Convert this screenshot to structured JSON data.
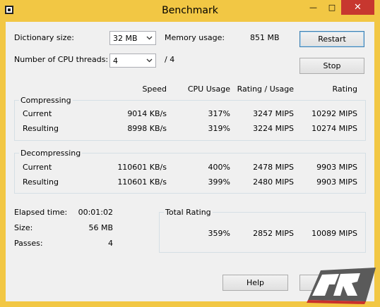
{
  "window": {
    "title": "Benchmark",
    "minimize_glyph": "—",
    "maximize_glyph": "□",
    "close_glyph": "✕",
    "frame_color": "#f2c744",
    "close_color": "#c7372f"
  },
  "settings": {
    "dictionary_size_label": "Dictionary size:",
    "dictionary_size_value": "32 MB",
    "cpu_threads_label": "Number of CPU threads:",
    "cpu_threads_value": "4",
    "cpu_threads_total": "/ 4",
    "memory_usage_label": "Memory usage:",
    "memory_usage_value": "851 MB"
  },
  "buttons": {
    "restart": "Restart",
    "stop": "Stop",
    "help": "Help"
  },
  "columns": {
    "speed": "Speed",
    "cpu_usage": "CPU Usage",
    "rating_usage": "Rating / Usage",
    "rating": "Rating"
  },
  "compressing": {
    "title": "Compressing",
    "rows": [
      {
        "label": "Current",
        "speed": "9014 KB/s",
        "cpu": "317%",
        "rating_usage": "3247 MIPS",
        "rating": "10292 MIPS"
      },
      {
        "label": "Resulting",
        "speed": "8998 KB/s",
        "cpu": "319%",
        "rating_usage": "3224 MIPS",
        "rating": "10274 MIPS"
      }
    ]
  },
  "decompressing": {
    "title": "Decompressing",
    "rows": [
      {
        "label": "Current",
        "speed": "110601 KB/s",
        "cpu": "400%",
        "rating_usage": "2478 MIPS",
        "rating": "9903 MIPS"
      },
      {
        "label": "Resulting",
        "speed": "110601 KB/s",
        "cpu": "399%",
        "rating_usage": "2480 MIPS",
        "rating": "9903 MIPS"
      }
    ]
  },
  "stats": {
    "elapsed_label": "Elapsed time:",
    "elapsed_value": "00:01:02",
    "size_label": "Size:",
    "size_value": "56 MB",
    "passes_label": "Passes:",
    "passes_value": "4"
  },
  "total": {
    "title": "Total Rating",
    "cpu": "359%",
    "rating_usage": "2852 MIPS",
    "rating": "10089 MIPS"
  },
  "watermark": {
    "icon": "legit-reviews-logo"
  }
}
